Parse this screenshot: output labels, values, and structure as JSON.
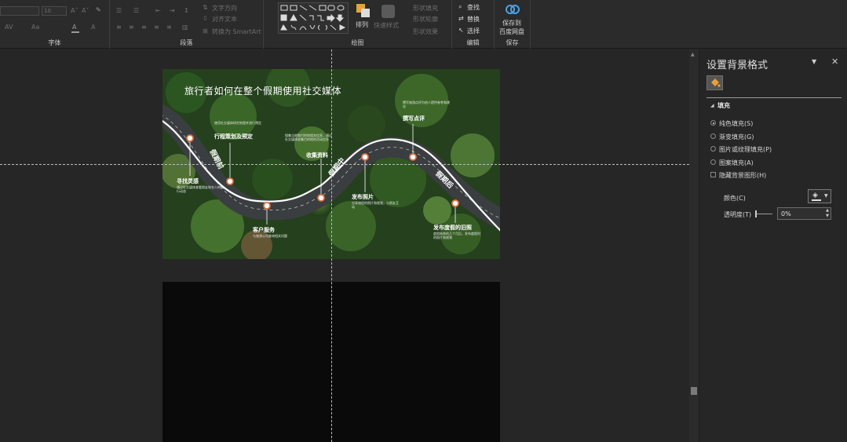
{
  "ribbon": {
    "groups": {
      "font": "字体",
      "paragraph": "段落",
      "drawing": "绘图",
      "editing": "编辑",
      "save": "保存"
    },
    "font_size": "10",
    "paragraph": {
      "text_direction": "文字方向",
      "align_text": "对齐文本",
      "convert_smartart": "转换为 SmartArt"
    },
    "drawing": {
      "arrange": "排列",
      "quick_styles": "快速样式",
      "shape_fill": "形状填充",
      "shape_outline": "形状轮廓",
      "shape_effects": "形状效果"
    },
    "editing": {
      "find": "查找",
      "replace": "替换",
      "select": "选择"
    },
    "save": {
      "line1": "保存到",
      "line2": "百度网盘"
    }
  },
  "slide": {
    "title": "旅行者如何在整个假期使用社交媒体",
    "phases": {
      "before": "假期前",
      "during": "假期中",
      "after": "假期后"
    },
    "milestones": [
      {
        "label": "寻找灵感",
        "desc": "通过社交媒体查看朋友和名人的旅行动态"
      },
      {
        "label": "行程策划及预定",
        "desc": "使用社交媒体研究地理并进行预定"
      },
      {
        "label": "客户服务",
        "desc": "与旅游公司查询相关问题"
      },
      {
        "label": "收集资料",
        "desc": "搜集当地和目的地相关信息，通过社交媒体收集目的地的活动信息"
      },
      {
        "label": "发布照片",
        "desc": "分享旅程的照片和视频，与朋友互动"
      },
      {
        "label": "撰写点评",
        "desc": "撰写旅游点评为他人提供参考和建议"
      },
      {
        "label": "发布度假的旧照",
        "desc": "度假结束的几个月后，发布度假时的照片和视频"
      }
    ]
  },
  "pane": {
    "title": "设置背景格式",
    "section": "填充",
    "options": [
      {
        "label": "纯色填充(S)",
        "selected": true
      },
      {
        "label": "渐变填充(G)",
        "selected": false
      },
      {
        "label": "图片或纹理填充(P)",
        "selected": false
      },
      {
        "label": "图案填充(A)",
        "selected": false
      }
    ],
    "hide_background": "隐藏背景图形(H)",
    "color_label": "颜色(C)",
    "transparency_label": "透明度(T)",
    "transparency_value": "0%"
  }
}
